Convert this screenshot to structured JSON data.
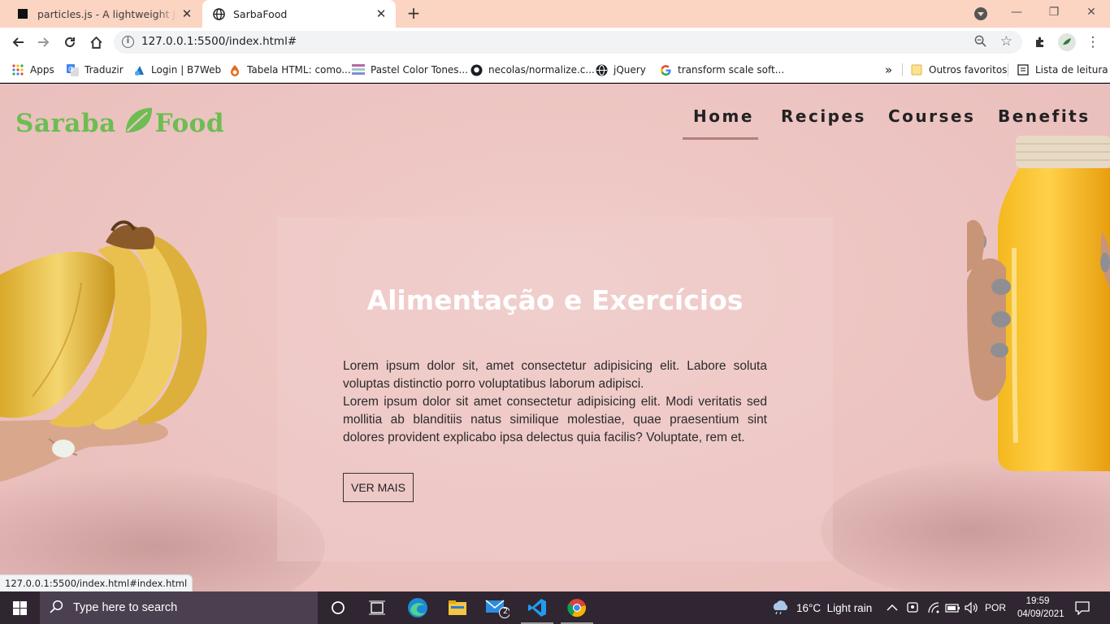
{
  "browser": {
    "tabs": [
      {
        "title": "particles.js - A lightweight JavaScript library for creating particles",
        "icon": "particles-favicon"
      },
      {
        "title": "SarbaFood",
        "icon": "globe-icon",
        "active": true
      }
    ],
    "new_tab_icon": "plus-icon",
    "url": "127.0.0.1:5500/index.html#",
    "status_url": "127.0.0.1:5500/index.html#index.html"
  },
  "bookmarks": {
    "items": [
      {
        "label": "Apps",
        "icon": "apps-grid-icon"
      },
      {
        "label": "Traduzir",
        "icon": "translate-icon"
      },
      {
        "label": "Login | B7Web",
        "icon": "b7web-icon"
      },
      {
        "label": "Tabela HTML: como...",
        "icon": "html-icon"
      },
      {
        "label": "Pastel Color Tones...",
        "icon": "palette-icon"
      },
      {
        "label": "necolas/normalize.c...",
        "icon": "github-icon"
      },
      {
        "label": "jQuery",
        "icon": "globe-icon"
      },
      {
        "label": "transform scale soft...",
        "icon": "google-icon"
      }
    ],
    "more": "»",
    "other_favorites": "Outros favoritos",
    "reading_list": "Lista de leitura"
  },
  "site": {
    "logo_left": "Saraba",
    "logo_right": "Food",
    "nav": [
      {
        "label": "Home",
        "active": true
      },
      {
        "label": "Recipes"
      },
      {
        "label": "Courses"
      },
      {
        "label": "Benefits"
      }
    ],
    "hero": {
      "title": "Alimentação e Exercícios",
      "paragraph1": "Lorem ipsum dolor sit, amet consectetur adipisicing elit. Labore soluta voluptas distinctio porro voluptatibus laborum adipisci.",
      "paragraph2": "Lorem ipsum dolor sit amet consectetur adipisicing elit. Modi veritatis sed mollitia ab blanditiis natus similique molestiae, quae praesentium sint dolores provident explicabo ipsa delectus quia facilis? Voluptate, rem et.",
      "button": "VER MAIS"
    }
  },
  "taskbar": {
    "search_placeholder": "Type here to search",
    "mail_badge": "2",
    "weather": "16°C  Light rain",
    "language": "POR",
    "time": "19:59",
    "date": "04/09/2021"
  },
  "colors": {
    "brand_green": "#6cbd52",
    "page_bg": "#edc5c2",
    "nav_underline": "#b3807e",
    "tab_strip": "#fbd4c2",
    "taskbar": "#2f2631"
  }
}
